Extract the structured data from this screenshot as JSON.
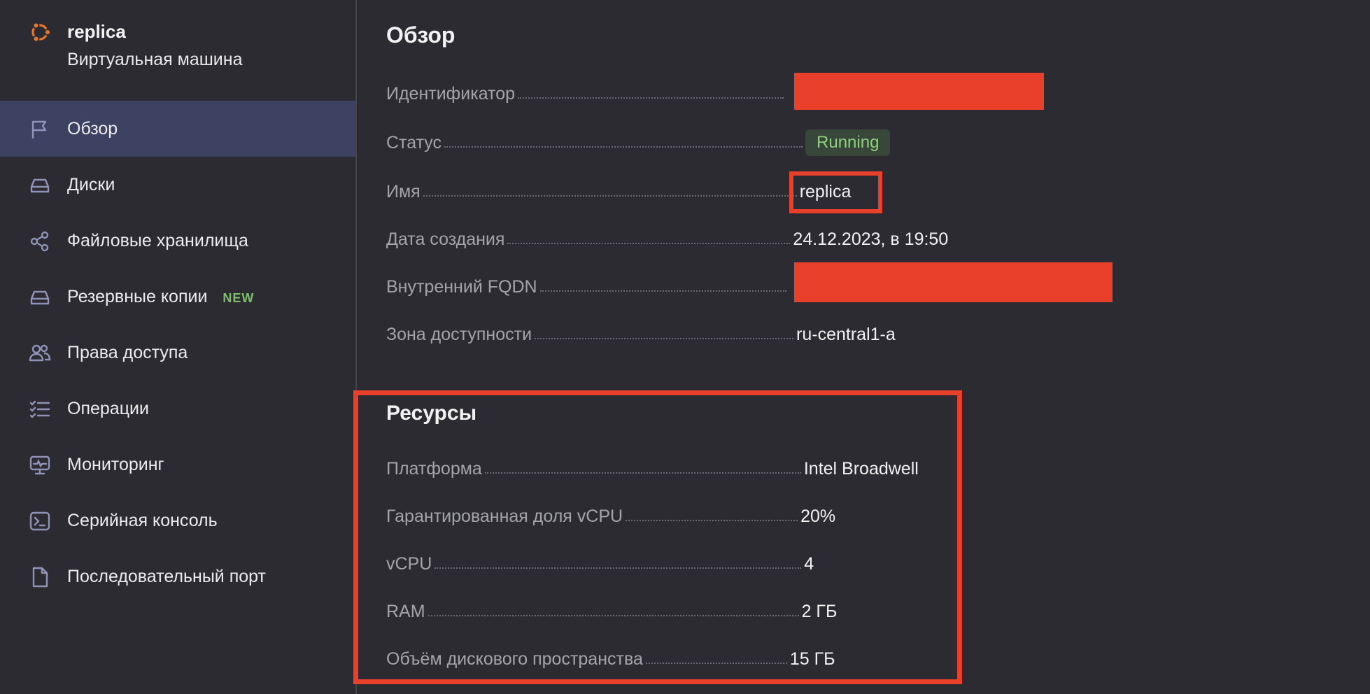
{
  "app": {
    "title": "replica",
    "subtitle": "Виртуальная машина",
    "icon": "ubuntu-icon",
    "accent": "#e9772b"
  },
  "sidebar": {
    "items": [
      {
        "label": "Обзор",
        "icon": "flag-icon",
        "active": true
      },
      {
        "label": "Диски",
        "icon": "disk-icon"
      },
      {
        "label": "Файловые хранилища",
        "icon": "share-nodes-icon"
      },
      {
        "label": "Резервные копии",
        "icon": "backup-icon",
        "badge": "NEW"
      },
      {
        "label": "Права доступа",
        "icon": "users-icon"
      },
      {
        "label": "Операции",
        "icon": "checklist-icon"
      },
      {
        "label": "Мониторинг",
        "icon": "monitor-icon"
      },
      {
        "label": "Серийная консоль",
        "icon": "terminal-icon"
      },
      {
        "label": "Последовательный порт",
        "icon": "file-icon"
      }
    ]
  },
  "overview": {
    "title": "Обзор",
    "rows": [
      {
        "key": "Идентификатор",
        "value": ""
      },
      {
        "key": "Статус",
        "value": "Running"
      },
      {
        "key": "Имя",
        "value": "replica"
      },
      {
        "key": "Дата создания",
        "value": "24.12.2023, в 19:50"
      },
      {
        "key": "Внутренний FQDN",
        "value": ""
      },
      {
        "key": "Зона доступности",
        "value": "ru-central1-a"
      }
    ]
  },
  "resources": {
    "title": "Ресурсы",
    "rows": [
      {
        "key": "Платформа",
        "value": "Intel Broadwell"
      },
      {
        "key": "Гарантированная доля vCPU",
        "value": "20%"
      },
      {
        "key": "vCPU",
        "value": "4"
      },
      {
        "key": "RAM",
        "value": "2 ГБ"
      },
      {
        "key": "Объём дискового пространства",
        "value": "15 ГБ"
      }
    ]
  },
  "colors": {
    "background": "#2c2b31",
    "active_nav": "#3d4262",
    "status_running_bg": "#38473a",
    "status_running_fg": "#8fd07d",
    "annotation_red": "#e8402a",
    "badge_new": "#7cbe6e"
  }
}
